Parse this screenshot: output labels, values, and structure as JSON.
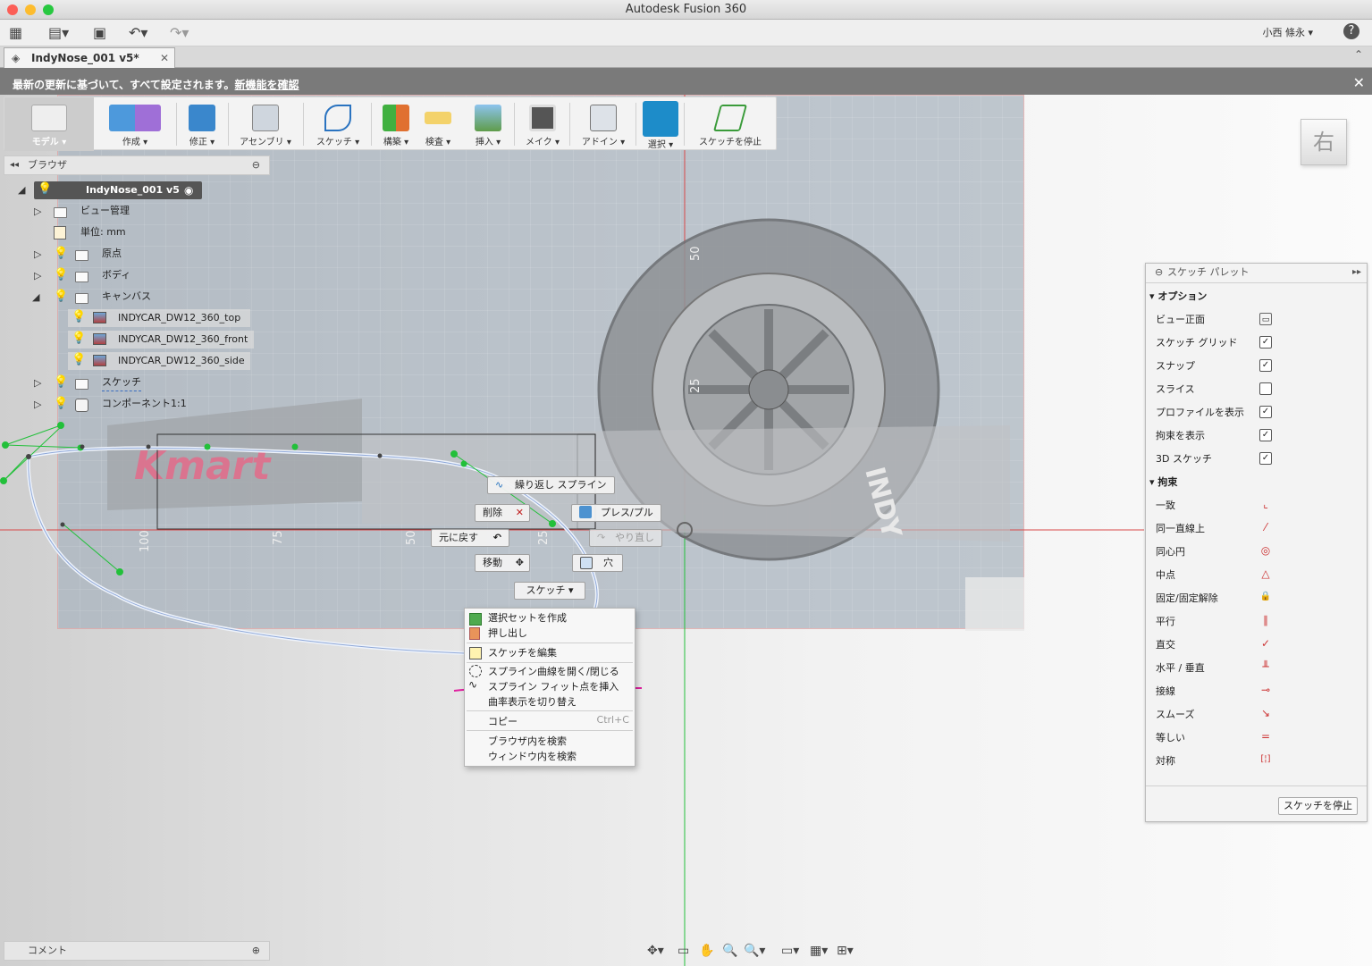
{
  "app": {
    "title": "Autodesk Fusion 360",
    "user": "小西 條永 ▾",
    "help": "?"
  },
  "document": {
    "tab_name": "IndyNose_001 v5*",
    "close": "✕"
  },
  "banner": {
    "text": "最新の更新に基づいて、すべて設定されます。",
    "link": "新機能を確認",
    "close": "✕"
  },
  "toolbar": {
    "workspace": "モデル ▾",
    "items": [
      {
        "label": "作成 ▾"
      },
      {
        "label": "修正 ▾"
      },
      {
        "label": "アセンブリ ▾"
      },
      {
        "label": "スケッチ ▾"
      },
      {
        "label": "構築 ▾"
      },
      {
        "label": "検査 ▾"
      },
      {
        "label": "挿入 ▾"
      },
      {
        "label": "メイク ▾"
      },
      {
        "label": "アドイン ▾"
      },
      {
        "label": "選択 ▾"
      },
      {
        "label": "スケッチを停止"
      }
    ]
  },
  "browser": {
    "title": "ブラウザ",
    "root": "IndyNose_001 v5",
    "items": [
      {
        "label": "ビュー管理"
      },
      {
        "label": "単位: mm"
      },
      {
        "label": "原点"
      },
      {
        "label": "ボディ"
      },
      {
        "label": "キャンバス"
      },
      {
        "label": "INDYCAR_DW12_360_top"
      },
      {
        "label": "INDYCAR_DW12_360_front"
      },
      {
        "label": "INDYCAR_DW12_360_side"
      },
      {
        "label": "スケッチ"
      },
      {
        "label": "コンポーネント1:1"
      }
    ]
  },
  "viewcube": {
    "label": "右"
  },
  "canvas_text": {
    "brand": "Kmart",
    "tire": "INDY",
    "ticks": [
      "100",
      "75",
      "50",
      "25",
      "50",
      "25"
    ]
  },
  "marking_menu": {
    "repeat": "繰り返し スプライン",
    "delete": "削除",
    "press_pull": "プレス/プル",
    "undo": "元に戻す",
    "redo": "やり直し",
    "move": "移動",
    "hole": "穴",
    "sketch": "スケッチ ▾"
  },
  "context_menu": {
    "items": [
      {
        "label": "選択セットを作成"
      },
      {
        "label": "押し出し"
      },
      {
        "label": "スケッチを編集"
      },
      {
        "label": "スプライン曲線を開く/閉じる"
      },
      {
        "label": "スプライン フィット点を挿入"
      },
      {
        "label": "曲率表示を切り替え"
      },
      {
        "label": "コピー",
        "shortcut": "Ctrl+C"
      },
      {
        "label": "ブラウザ内を検索"
      },
      {
        "label": "ウィンドウ内を検索"
      }
    ]
  },
  "palette": {
    "title": "スケッチ パレット",
    "options_header": "オプション",
    "options": [
      {
        "label": "ビュー正面",
        "checked": null
      },
      {
        "label": "スケッチ グリッド",
        "checked": true
      },
      {
        "label": "スナップ",
        "checked": true
      },
      {
        "label": "スライス",
        "checked": false
      },
      {
        "label": "プロファイルを表示",
        "checked": true
      },
      {
        "label": "拘束を表示",
        "checked": true
      },
      {
        "label": "3D スケッチ",
        "checked": true
      }
    ],
    "constraints_header": "拘束",
    "constraints": [
      {
        "label": "一致",
        "glyph": "⌞"
      },
      {
        "label": "同一直線上",
        "glyph": "⁄"
      },
      {
        "label": "同心円",
        "glyph": "◎"
      },
      {
        "label": "中点",
        "glyph": "△"
      },
      {
        "label": "固定/固定解除",
        "glyph": "🔒"
      },
      {
        "label": "平行",
        "glyph": "∥"
      },
      {
        "label": "直交",
        "glyph": "✓"
      },
      {
        "label": "水平 / 垂直",
        "glyph": "╨"
      },
      {
        "label": "接線",
        "glyph": "⊸"
      },
      {
        "label": "スムーズ",
        "glyph": "↘"
      },
      {
        "label": "等しい",
        "glyph": "="
      },
      {
        "label": "対称",
        "glyph": "[¦]"
      }
    ],
    "stop_button": "スケッチを停止"
  },
  "comment": {
    "label": "コメント"
  },
  "colors": {
    "accent": "#1d8cc9",
    "sketch_green": "#22c03a",
    "axis_red": "#d94848",
    "highlight": "#e020a0"
  }
}
